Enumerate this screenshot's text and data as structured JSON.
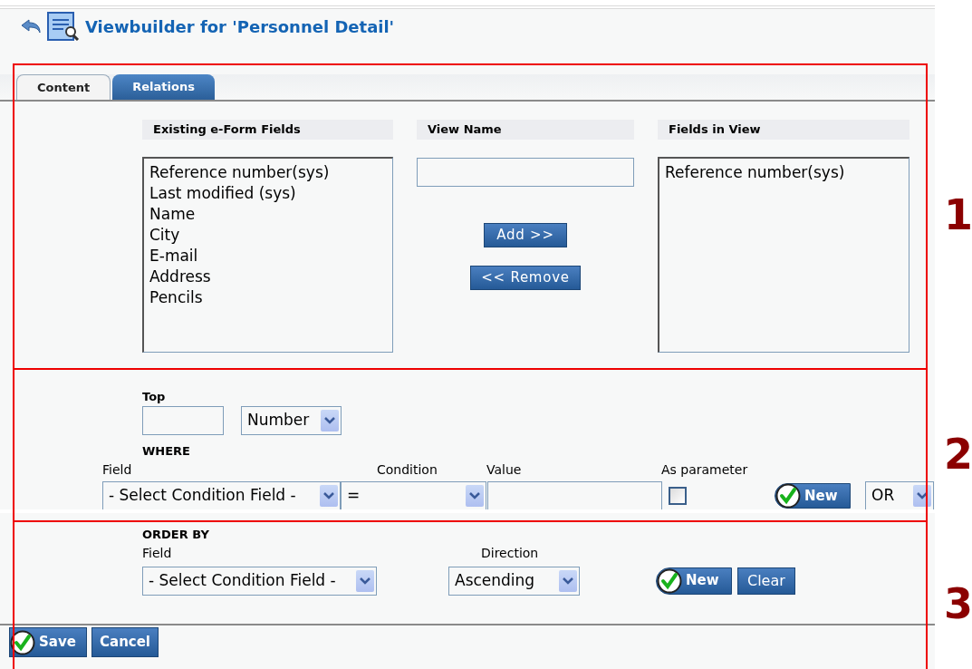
{
  "header": {
    "title": "Viewbuilder for 'Personnel Detail'"
  },
  "tabs": [
    {
      "label": "Content",
      "selected": true
    },
    {
      "label": "Relations",
      "selected": false
    }
  ],
  "content": {
    "existing_fields": {
      "heading": "Existing e-Form Fields",
      "items": [
        "Reference number(sys)",
        "Last modified (sys)",
        "Name",
        "City",
        "E-mail",
        "Address",
        "Pencils"
      ]
    },
    "view_name": {
      "heading": "View Name"
    },
    "fields_in_view": {
      "heading": "Fields in View",
      "items": [
        "Reference number(sys)"
      ]
    },
    "add_button": "Add >>",
    "remove_button": "<< Remove"
  },
  "top": {
    "label": "Top",
    "unit": "Number"
  },
  "where": {
    "label": "WHERE",
    "field_label": "Field",
    "condition_label": "Condition",
    "value_label": "Value",
    "parameter_label": "As parameter",
    "field": "- Select Condition Field -",
    "condition": "=",
    "as_parameter": false,
    "new_button": "New",
    "connector": "OR"
  },
  "order_by": {
    "label": "ORDER BY",
    "field_label": "Field",
    "direction_label": "Direction",
    "field": "- Select Condition Field -",
    "direction": "Ascending",
    "new_button": "New",
    "clear_button": "Clear"
  },
  "footer": {
    "save_button": "Save",
    "cancel_button": "Cancel"
  },
  "annotations": [
    "1",
    "2",
    "3"
  ]
}
